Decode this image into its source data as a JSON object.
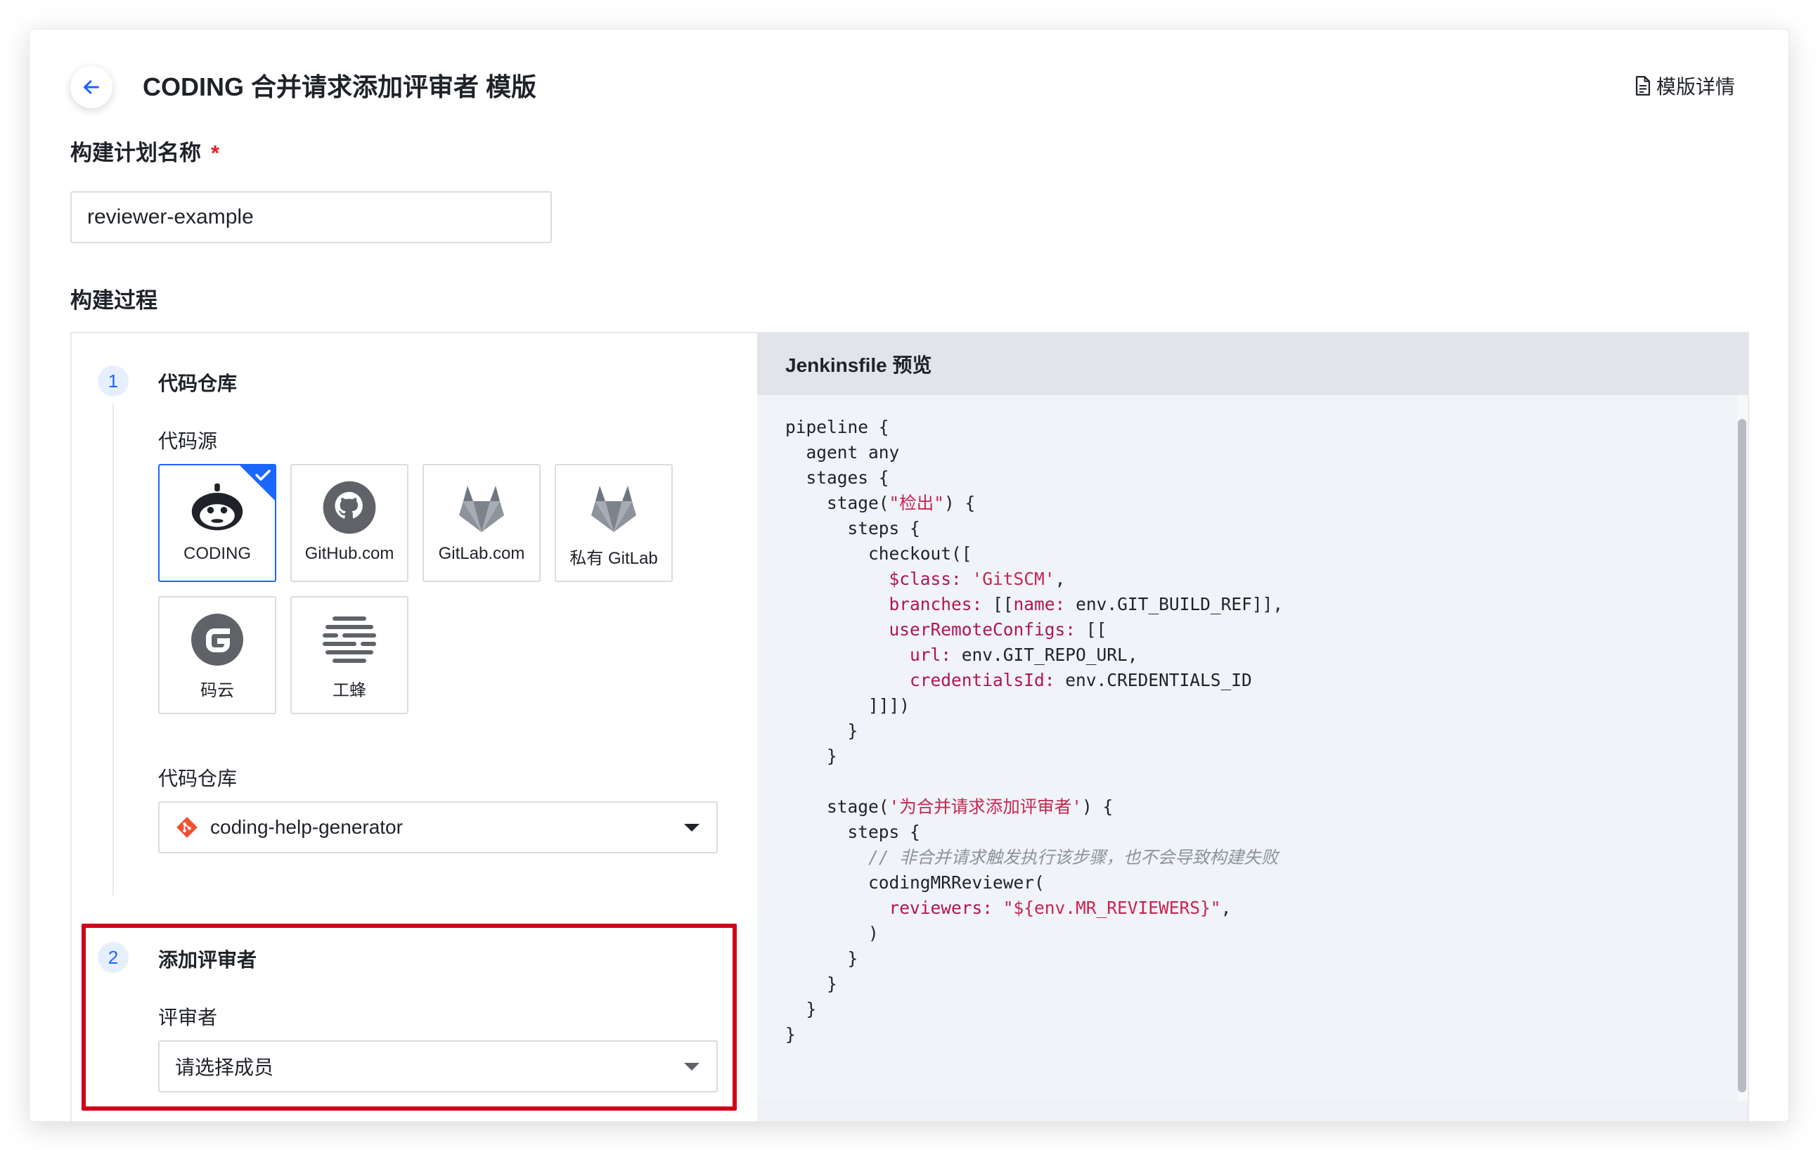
{
  "header": {
    "title": "CODING 合并请求添加评审者 模版",
    "template_detail_label": "模版详情"
  },
  "form": {
    "name_label": "构建计划名称",
    "required_mark": "*",
    "name_value": "reviewer-example",
    "process_label": "构建过程"
  },
  "steps": [
    {
      "number": "1",
      "title": "代码仓库",
      "source_label": "代码源",
      "sources": [
        {
          "label": "CODING",
          "icon": "coding-monkey-icon",
          "selected": true
        },
        {
          "label": "GitHub.com",
          "icon": "github-icon",
          "selected": false
        },
        {
          "label": "GitLab.com",
          "icon": "gitlab-icon",
          "selected": false
        },
        {
          "label": "私有 GitLab",
          "icon": "gitlab-icon",
          "selected": false
        },
        {
          "label": "码云",
          "icon": "gitee-icon",
          "selected": false
        },
        {
          "label": "工蜂",
          "icon": "gongfeng-icon",
          "selected": false
        }
      ],
      "repo_label": "代码仓库",
      "repo_value": "coding-help-generator"
    },
    {
      "number": "2",
      "title": "添加评审者",
      "reviewer_label": "评审者",
      "reviewer_placeholder": "请选择成员"
    }
  ],
  "preview": {
    "title": "Jenkinsfile 预览"
  },
  "colors": {
    "accent": "#1a66ff",
    "highlight": "#d0021b",
    "string": "#c7254e",
    "comment": "#8c939d"
  }
}
